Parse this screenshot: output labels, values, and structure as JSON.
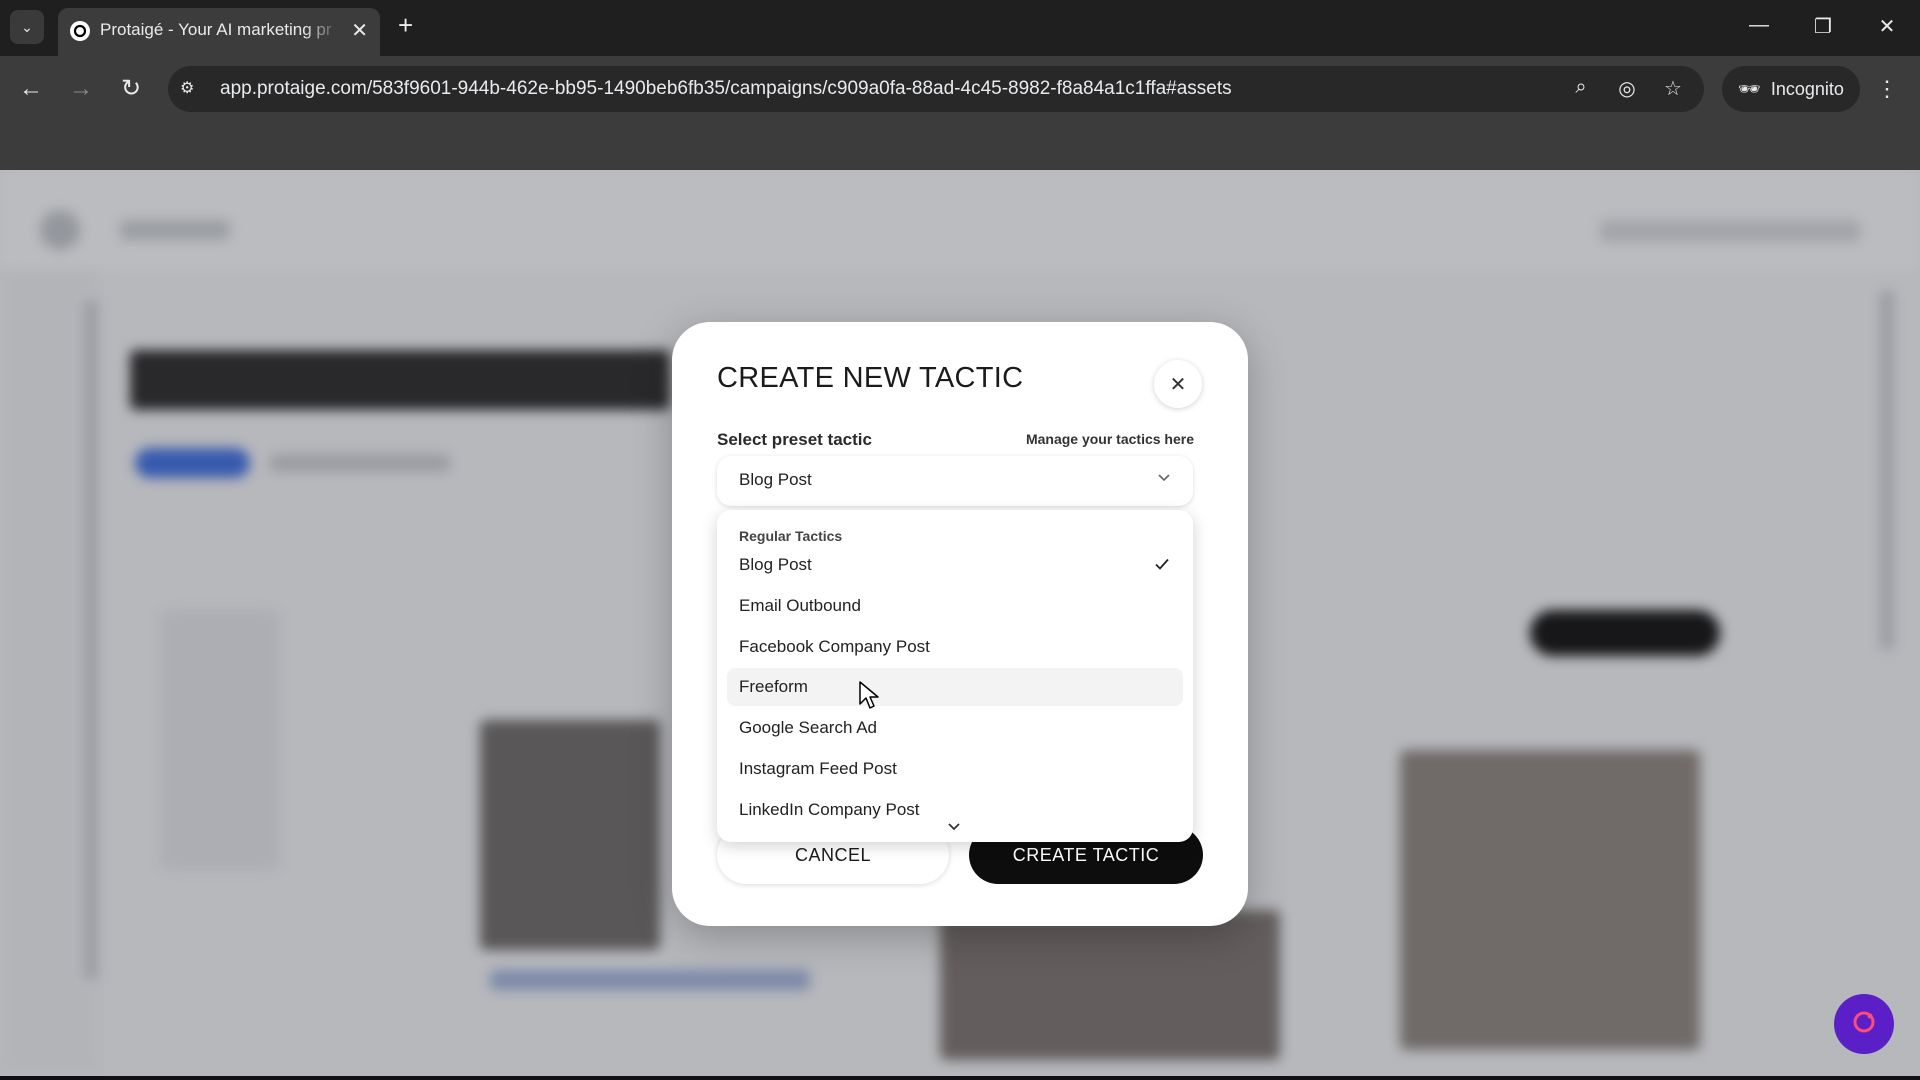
{
  "browser": {
    "tab_title": "Protaigé - Your AI marketing pr",
    "url": "app.protaige.com/583f9601-944b-462e-bb95-1490beb6fb35/campaigns/c909a0fa-88ad-4c45-8982-f8a84a1c1ffa#assets",
    "incognito_label": "Incognito",
    "new_tab_symbol": "+",
    "tab_close_symbol": "✕"
  },
  "modal": {
    "title": "CREATE NEW TACTIC",
    "close_symbol": "✕",
    "field_label": "Select preset tactic",
    "manage_link": "Manage your tactics here",
    "selected_value": "Blog Post",
    "dropdown": {
      "group_label": "Regular Tactics",
      "options": [
        {
          "label": "Blog Post",
          "selected": true
        },
        {
          "label": "Email Outbound"
        },
        {
          "label": "Facebook Company Post"
        },
        {
          "label": "Freeform",
          "hovered": true
        },
        {
          "label": "Google Search Ad"
        },
        {
          "label": "Instagram Feed Post"
        },
        {
          "label": "LinkedIn Company Post"
        }
      ]
    },
    "cancel_label": "CANCEL",
    "create_label": "CREATE TACTIC"
  },
  "colors": {
    "primary_button": "#0d0d0d",
    "help_fab": "#5b1fc7"
  },
  "icons": {
    "selected_option": "check-icon",
    "select_toggle": "chevron-down-icon",
    "help": "protaige-logo-icon"
  }
}
